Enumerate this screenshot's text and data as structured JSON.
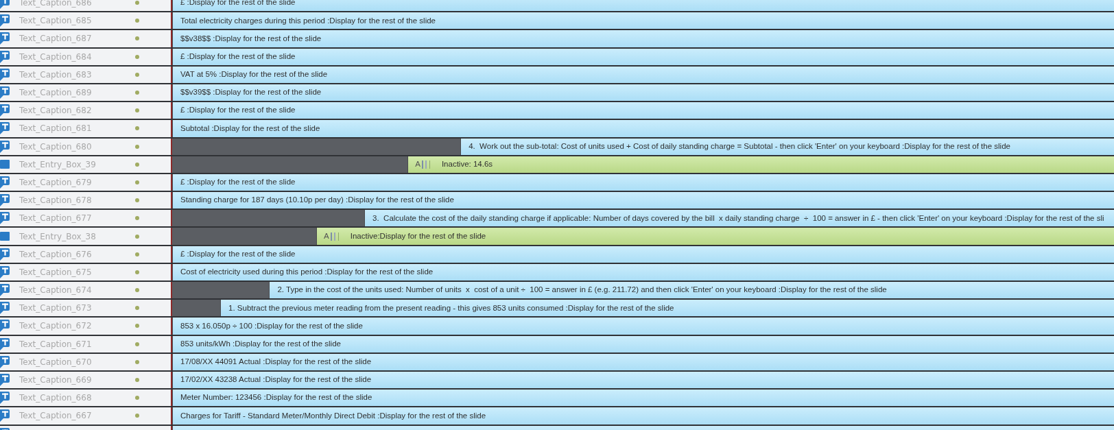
{
  "rows": [
    {
      "kind": "caption",
      "name": "Text_Caption_686",
      "bar_text": "£ :Display for the rest of the slide",
      "level": 1
    },
    {
      "kind": "caption",
      "name": "Text_Caption_685",
      "bar_text": "Total electricity charges during this period :Display for the rest of the slide",
      "level": 1
    },
    {
      "kind": "caption",
      "name": "Text_Caption_687",
      "bar_text": "$$v38$$ :Display for the rest of the slide",
      "level": 1
    },
    {
      "kind": "caption",
      "name": "Text_Caption_684",
      "bar_text": "£ :Display for the rest of the slide",
      "level": 1
    },
    {
      "kind": "caption",
      "name": "Text_Caption_683",
      "bar_text": "VAT at 5% :Display for the rest of the slide",
      "level": 1
    },
    {
      "kind": "caption",
      "name": "Text_Caption_689",
      "bar_text": "$$v39$$ :Display for the rest of the slide",
      "level": 1
    },
    {
      "kind": "caption",
      "name": "Text_Caption_682",
      "bar_text": "£ :Display for the rest of the slide",
      "level": 1
    },
    {
      "kind": "caption",
      "name": "Text_Caption_681",
      "bar_text": "Subtotal :Display for the rest of the slide",
      "level": 1
    },
    {
      "kind": "caption",
      "name": "Text_Caption_680",
      "bar_text": "4.  Work out the sub-total: Cost of units used + Cost of daily standing charge = Subtotal - then click 'Enter' on your keyboard :Display for the rest of the slide",
      "level": 0.694
    },
    {
      "kind": "entry",
      "name": "Text_Entry_Box_39",
      "glyph": "A",
      "bar_text": "Inactive: 14.6s",
      "level": 0.75
    },
    {
      "kind": "caption",
      "name": "Text_Caption_679",
      "bar_text": "£ :Display for the rest of the slide",
      "level": 1
    },
    {
      "kind": "caption",
      "name": "Text_Caption_678",
      "bar_text": "Standing charge for 187 days (10.10p per day) :Display for the rest of the slide",
      "level": 1
    },
    {
      "kind": "caption",
      "name": "Text_Caption_677",
      "bar_text": "3.  Calculate the cost of the daily standing charge if applicable: Number of days covered by the bill  x daily standing charge  ÷  100 = answer in £ - then click 'Enter' on your keyboard :Display for the rest of the sli",
      "level": 0.796
    },
    {
      "kind": "entry",
      "name": "Text_Entry_Box_38",
      "glyph": "A",
      "bar_text": "Inactive:Display for the rest of the slide",
      "level": 0.847
    },
    {
      "kind": "caption",
      "name": "Text_Caption_676",
      "bar_text": "£ :Display for the rest of the slide",
      "level": 1
    },
    {
      "kind": "caption",
      "name": "Text_Caption_675",
      "bar_text": "Cost of electricity used during this period :Display for the rest of the slide",
      "level": 1
    },
    {
      "kind": "caption",
      "name": "Text_Caption_674",
      "bar_text": "2. Type in the cost of the units used: Number of units  x  cost of a unit ÷  100 = answer in £ (e.g. 211.72) and then click 'Enter' on your keyboard :Display for the rest of the slide",
      "level": 0.897
    },
    {
      "kind": "caption",
      "name": "Text_Caption_673",
      "bar_text": "1. Subtract the previous meter reading from the present reading - this gives 853 units consumed :Display for the rest of the slide",
      "level": 0.949
    },
    {
      "kind": "caption",
      "name": "Text_Caption_672",
      "bar_text": "853 x 16.050p ÷ 100 :Display for the rest of the slide",
      "level": 1
    },
    {
      "kind": "caption",
      "name": "Text_Caption_671",
      "bar_text": "853 units/kWh :Display for the rest of the slide",
      "level": 1
    },
    {
      "kind": "caption",
      "name": "Text_Caption_670",
      "bar_text": "17/08/XX 44091 Actual :Display for the rest of the slide",
      "level": 1
    },
    {
      "kind": "caption",
      "name": "Text_Caption_669",
      "bar_text": "17/02/XX 43238 Actual :Display for the rest of the slide",
      "level": 1
    },
    {
      "kind": "caption",
      "name": "Text_Caption_668",
      "bar_text": "Meter Number: 123456 :Display for the rest of the slide",
      "level": 1
    },
    {
      "kind": "caption",
      "name": "Text_Caption_667",
      "bar_text": "Charges for Tariff - Standard Meter/Monthly Direct Debit :Display for the rest of the slide",
      "level": 1
    },
    {
      "kind": "caption",
      "level": 1
    }
  ]
}
